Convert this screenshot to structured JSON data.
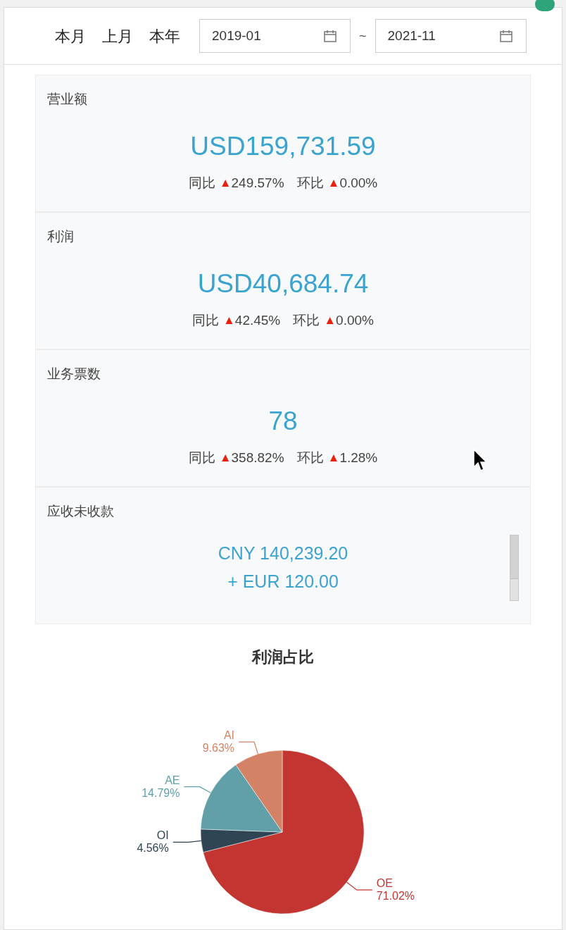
{
  "quick_ranges": [
    {
      "label": "本月"
    },
    {
      "label": "上月"
    },
    {
      "label": "本年"
    }
  ],
  "date_range": {
    "start": "2019-01",
    "separator": "~",
    "end": "2021-11"
  },
  "cards": [
    {
      "title": "营业额",
      "values": [
        "USD159,731.59"
      ],
      "stats": [
        {
          "label": "同比",
          "arrow": "▲",
          "value": "249.57%"
        },
        {
          "label": "环比",
          "arrow": "▲",
          "value": "0.00%"
        }
      ]
    },
    {
      "title": "利润",
      "values": [
        "USD40,684.74"
      ],
      "stats": [
        {
          "label": "同比",
          "arrow": "▲",
          "value": "42.45%"
        },
        {
          "label": "环比",
          "arrow": "▲",
          "value": "0.00%"
        }
      ]
    },
    {
      "title": "业务票数",
      "values": [
        "78"
      ],
      "stats": [
        {
          "label": "同比",
          "arrow": "▲",
          "value": "358.82%"
        },
        {
          "label": "环比",
          "arrow": "▲",
          "value": "1.28%"
        }
      ]
    },
    {
      "title": "应收未收款",
      "values": [
        "CNY 140,239.20",
        "+ EUR 120.00"
      ],
      "scrollable": true
    }
  ],
  "chart": {
    "chart_data": {
      "type": "pie",
      "title": "利润占比",
      "categories": [
        "OE",
        "OI",
        "AE",
        "AI"
      ],
      "values": [
        71.02,
        4.56,
        14.79,
        9.63
      ],
      "colors": [
        "#c23531",
        "#2f4554",
        "#61a0a8",
        "#d48265"
      ],
      "value_labels": [
        "71.02%",
        "4.56%",
        "14.79%",
        "9.63%"
      ]
    }
  }
}
